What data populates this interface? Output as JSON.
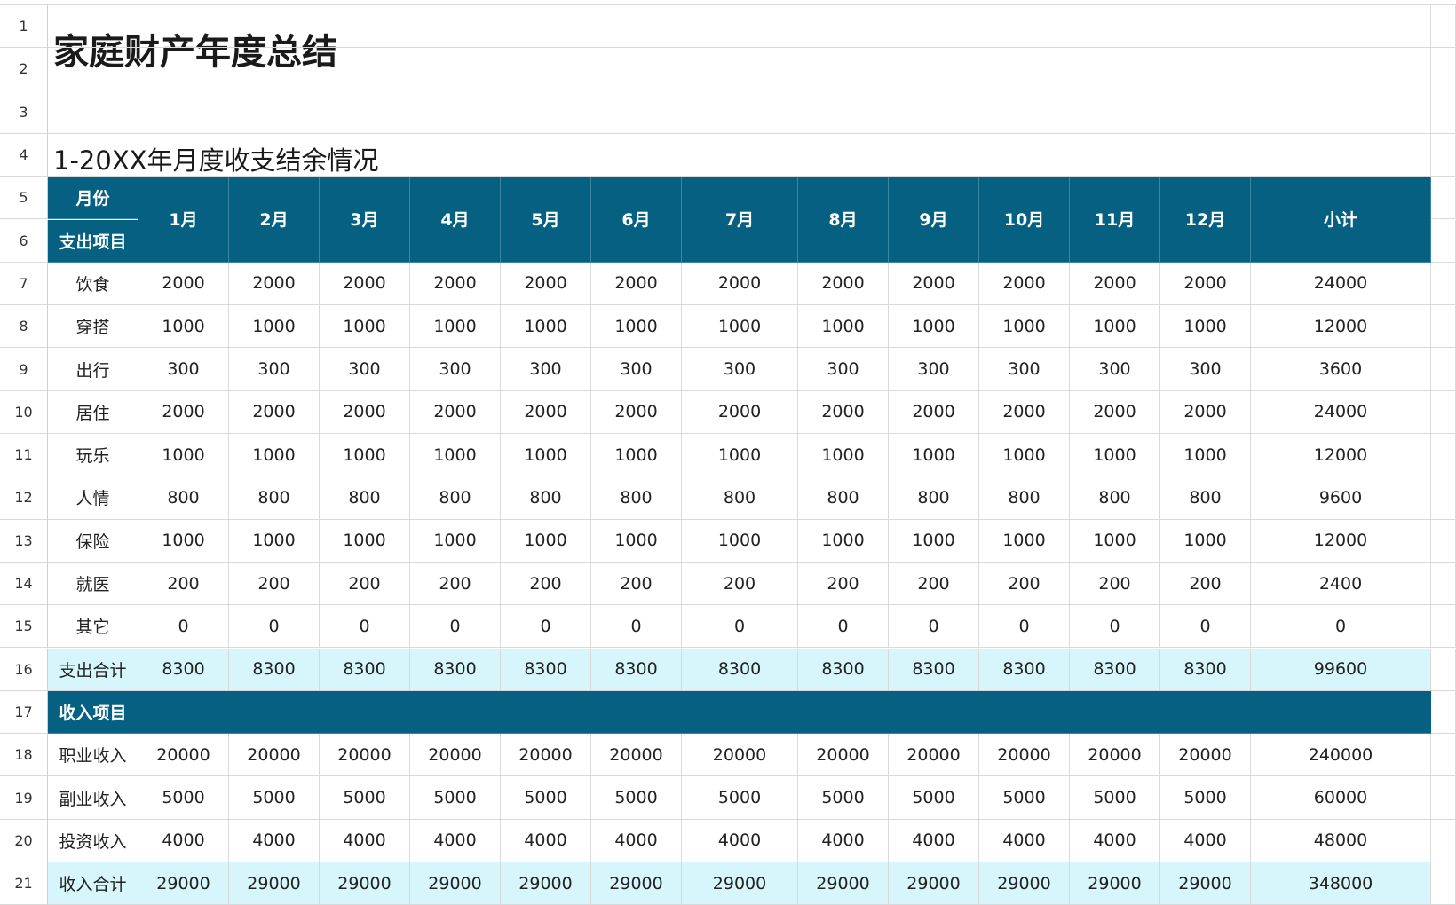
{
  "sheet": {
    "title": "家庭财产年度总结",
    "subtitle": "1-20XX年月度收支结余情况",
    "row_numbers": [
      "1",
      "2",
      "3",
      "4",
      "5",
      "6",
      "7",
      "8",
      "9",
      "10",
      "11",
      "12",
      "13",
      "14",
      "15",
      "16",
      "17",
      "18",
      "19",
      "20",
      "21"
    ],
    "header": {
      "corner_top": "月份",
      "corner_bottom": "支出项目",
      "months": [
        "1月",
        "2月",
        "3月",
        "4月",
        "5月",
        "6月",
        "7月",
        "8月",
        "9月",
        "10月",
        "11月",
        "12月"
      ],
      "subtotal": "小计"
    },
    "expense_rows": [
      {
        "label": "饮食",
        "values": [
          "2000",
          "2000",
          "2000",
          "2000",
          "2000",
          "2000",
          "2000",
          "2000",
          "2000",
          "2000",
          "2000",
          "2000"
        ],
        "total": "24000"
      },
      {
        "label": "穿搭",
        "values": [
          "1000",
          "1000",
          "1000",
          "1000",
          "1000",
          "1000",
          "1000",
          "1000",
          "1000",
          "1000",
          "1000",
          "1000"
        ],
        "total": "12000"
      },
      {
        "label": "出行",
        "values": [
          "300",
          "300",
          "300",
          "300",
          "300",
          "300",
          "300",
          "300",
          "300",
          "300",
          "300",
          "300"
        ],
        "total": "3600"
      },
      {
        "label": "居住",
        "values": [
          "2000",
          "2000",
          "2000",
          "2000",
          "2000",
          "2000",
          "2000",
          "2000",
          "2000",
          "2000",
          "2000",
          "2000"
        ],
        "total": "24000"
      },
      {
        "label": "玩乐",
        "values": [
          "1000",
          "1000",
          "1000",
          "1000",
          "1000",
          "1000",
          "1000",
          "1000",
          "1000",
          "1000",
          "1000",
          "1000"
        ],
        "total": "12000"
      },
      {
        "label": "人情",
        "values": [
          "800",
          "800",
          "800",
          "800",
          "800",
          "800",
          "800",
          "800",
          "800",
          "800",
          "800",
          "800"
        ],
        "total": "9600"
      },
      {
        "label": "保险",
        "values": [
          "1000",
          "1000",
          "1000",
          "1000",
          "1000",
          "1000",
          "1000",
          "1000",
          "1000",
          "1000",
          "1000",
          "1000"
        ],
        "total": "12000"
      },
      {
        "label": "就医",
        "values": [
          "200",
          "200",
          "200",
          "200",
          "200",
          "200",
          "200",
          "200",
          "200",
          "200",
          "200",
          "200"
        ],
        "total": "2400"
      },
      {
        "label": "其它",
        "values": [
          "0",
          "0",
          "0",
          "0",
          "0",
          "0",
          "0",
          "0",
          "0",
          "0",
          "0",
          "0"
        ],
        "total": "0"
      }
    ],
    "expense_total": {
      "label": "支出合计",
      "values": [
        "8300",
        "8300",
        "8300",
        "8300",
        "8300",
        "8300",
        "8300",
        "8300",
        "8300",
        "8300",
        "8300",
        "8300"
      ],
      "total": "99600"
    },
    "income_header": "收入项目",
    "income_rows": [
      {
        "label": "职业收入",
        "values": [
          "20000",
          "20000",
          "20000",
          "20000",
          "20000",
          "20000",
          "20000",
          "20000",
          "20000",
          "20000",
          "20000",
          "20000"
        ],
        "total": "240000"
      },
      {
        "label": "副业收入",
        "values": [
          "5000",
          "5000",
          "5000",
          "5000",
          "5000",
          "5000",
          "5000",
          "5000",
          "5000",
          "5000",
          "5000",
          "5000"
        ],
        "total": "60000"
      },
      {
        "label": "投资收入",
        "values": [
          "4000",
          "4000",
          "4000",
          "4000",
          "4000",
          "4000",
          "4000",
          "4000",
          "4000",
          "4000",
          "4000",
          "4000"
        ],
        "total": "48000"
      }
    ],
    "income_total": {
      "label": "收入合计",
      "values": [
        "29000",
        "29000",
        "29000",
        "29000",
        "29000",
        "29000",
        "29000",
        "29000",
        "29000",
        "29000",
        "29000",
        "29000"
      ],
      "total": "348000"
    }
  },
  "colors": {
    "header_bg": "#056082",
    "total_bg": "#d6f6fb",
    "grid": "#d9d9d9"
  }
}
